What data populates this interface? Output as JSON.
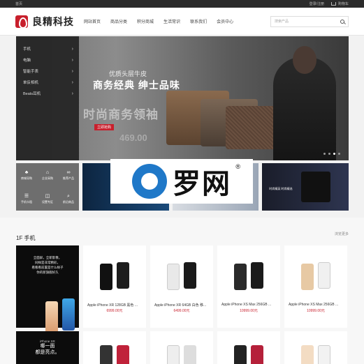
{
  "topbar": {
    "left": "首页",
    "auth": "登录/注册",
    "cart": "购物车"
  },
  "header": {
    "logo": "良精科技",
    "search_placeholder": "搜索产品"
  },
  "nav": [
    "网站首页",
    "商品分类",
    "积分商城",
    "生活常识",
    "联系我们",
    "会员中心"
  ],
  "hero": {
    "categories": [
      "手机",
      "电脑",
      "智能手表",
      "单反相机",
      "Beats耳机"
    ],
    "slogan_small": "优质头层牛皮",
    "slogan_main": "商务经典 绅士品味",
    "slogan_ghost": "时尚商务领袖",
    "tag": "立即抢购",
    "ghost_price": "469.00",
    "dots": 4,
    "active_dot": 3
  },
  "quick_links": [
    {
      "icon": "tree-icon",
      "glyph": "♣",
      "label": "商城导购"
    },
    {
      "icon": "building-icon",
      "glyph": "⌂",
      "label": "企业采购"
    },
    {
      "icon": "link-icon",
      "glyph": "∞",
      "label": "推荐产品"
    },
    {
      "icon": "list-icon",
      "glyph": "☰",
      "label": "手机卡租"
    },
    {
      "icon": "shield-icon",
      "glyph": "◫",
      "label": "设置专区"
    },
    {
      "icon": "search-icon",
      "glyph": "⌕",
      "label": "前沿商品"
    }
  ],
  "banner_tile_text": "时尚精英 时尚精选",
  "watermark": {
    "text": "罗网",
    "reg": "®"
  },
  "section": {
    "title": "1F 手机",
    "more": "浏览更多",
    "promo_text": [
      "全面屏，全新影像，",
      "同样是非常精彩，",
      "看看看前置是什么样子",
      "你的新旗舰好久"
    ],
    "products": [
      {
        "name": "Apple iPhone XR 128GB 黑色 ...",
        "price": "6999.00元",
        "colors": [
          "#111111",
          "#1d1d1d"
        ]
      },
      {
        "name": "Apple iPhone XR 64GB 白色 移...",
        "price": "6499.00元",
        "colors": [
          "#e9e9e9",
          "#1a1a1a"
        ]
      },
      {
        "name": "Apple iPhone XS Max 256GB ...",
        "price": "10999.00元",
        "colors": [
          "#2a2a2a",
          "#1a1a1a"
        ]
      },
      {
        "name": "Apple iPhone XS Max 256GB ...",
        "price": "10999.00元",
        "colors": [
          "#e7c9a4",
          "#f0f0f0"
        ]
      }
    ],
    "promo2": {
      "small": "iPhone XR",
      "big_1": "哪一面",
      "big_2": "都是亮点。"
    }
  }
}
